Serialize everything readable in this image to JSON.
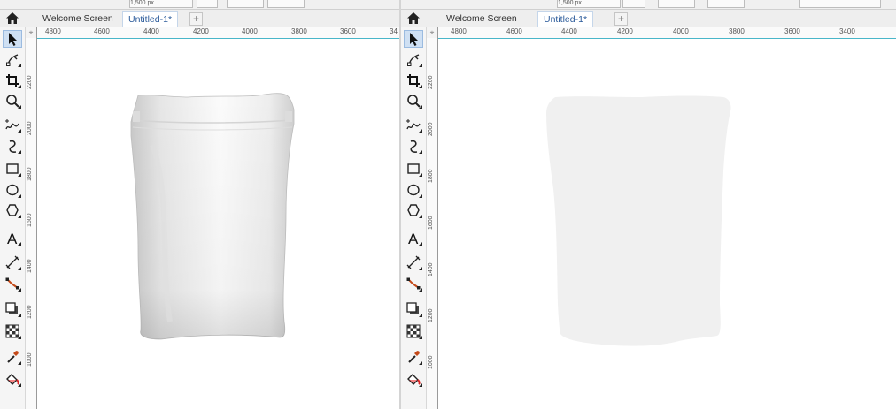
{
  "window": {
    "tabs": [
      {
        "label": "Welcome Screen",
        "active": false
      },
      {
        "label": "Untitled-1*",
        "active": true
      }
    ],
    "add_tab_label": "+",
    "top_strip_values": [
      "1,500 px",
      "1,500 px"
    ]
  },
  "toolbox": {
    "tools": [
      {
        "name": "pick-tool",
        "icon": "pointer-icon",
        "selected": true
      },
      {
        "name": "shape-tool",
        "icon": "shape-node-icon"
      },
      {
        "name": "crop-tool",
        "icon": "crop-icon"
      },
      {
        "name": "zoom-tool",
        "icon": "magnifier-icon"
      },
      {
        "name": "freehand-tool",
        "icon": "freehand-icon"
      },
      {
        "name": "artistic-media-tool",
        "icon": "artistic-media-icon"
      },
      {
        "name": "rectangle-tool",
        "icon": "rectangle-icon"
      },
      {
        "name": "ellipse-tool",
        "icon": "ellipse-icon"
      },
      {
        "name": "polygon-tool",
        "icon": "polygon-icon"
      },
      {
        "name": "text-tool",
        "icon": "text-icon",
        "glyph": "A"
      },
      {
        "name": "parallel-dimension-tool",
        "icon": "dimension-icon"
      },
      {
        "name": "connector-tool",
        "icon": "connector-icon"
      },
      {
        "name": "drop-shadow-tool",
        "icon": "drop-shadow-icon"
      },
      {
        "name": "transparency-tool",
        "icon": "transparency-icon"
      },
      {
        "name": "eyedropper-tool",
        "icon": "eyedropper-icon"
      },
      {
        "name": "interactive-fill-tool",
        "icon": "fill-bucket-icon"
      }
    ]
  },
  "rulers": {
    "horizontal_left": [
      "4800",
      "4600",
      "4400",
      "4200",
      "4000",
      "3800",
      "3600",
      "34"
    ],
    "horizontal_right": [
      "4800",
      "4600",
      "4400",
      "4200",
      "4000",
      "3800",
      "3600",
      "3400"
    ],
    "vertical": [
      "2200",
      "2000",
      "1800",
      "1600",
      "1400",
      "1200",
      "1000"
    ],
    "corner_symbol": "⌖"
  },
  "colors": {
    "accent": "#49b6c9",
    "tab_active_text": "#2a5a9a",
    "silhouette_fill": "#f0f0f0"
  },
  "canvas": {
    "left_content": "white stand-up pouch mockup",
    "right_content": "light gray pouch silhouette"
  }
}
